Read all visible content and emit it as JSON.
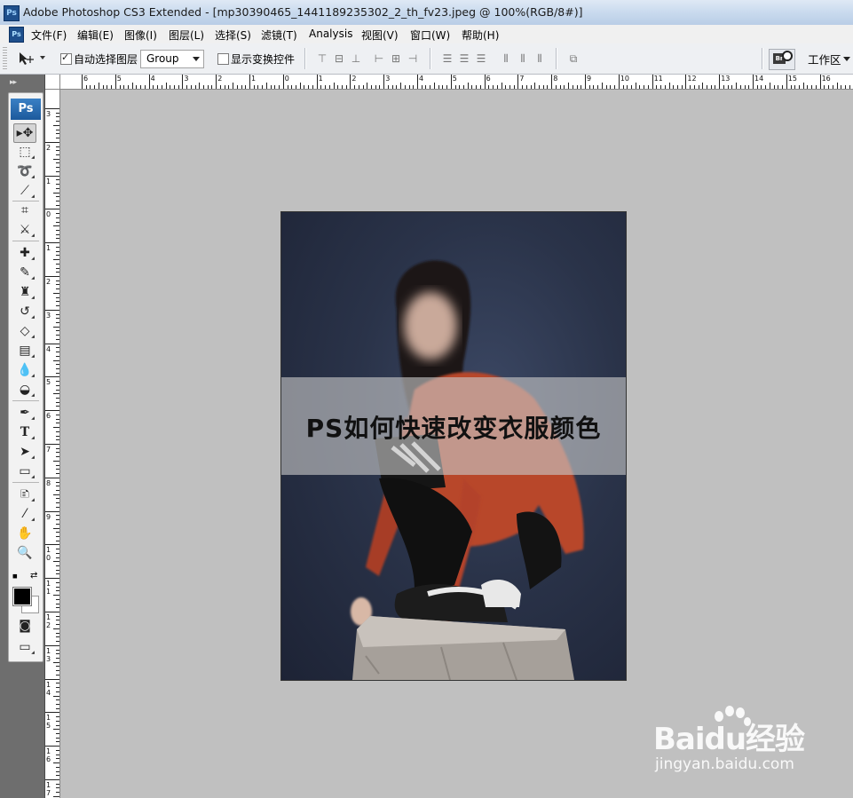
{
  "window": {
    "app_icon": "photoshop-icon",
    "title": "Adobe Photoshop CS3 Extended - [mp30390465_1441189235302_2_th_fv23.jpeg @ 100%(RGB/8#)]"
  },
  "menu": {
    "doc_icon_text": "Ps",
    "items": [
      "文件(F)",
      "编辑(E)",
      "图像(I)",
      "图层(L)",
      "选择(S)",
      "滤镜(T)",
      "Analysis",
      "视图(V)",
      "窗口(W)",
      "帮助(H)"
    ]
  },
  "options": {
    "tool_icon": "move-tool-icon",
    "auto_select_label": "自动选择图层",
    "auto_select_checked": true,
    "select_value": "Group",
    "show_transform_label": "显示变换控件",
    "show_transform_checked": false,
    "bridge_label": "Br",
    "workspace_label": "工作区"
  },
  "toolbox": {
    "logo": "Ps",
    "tools": [
      "move-tool-icon",
      "marquee-tool-icon",
      "lasso-tool-icon",
      "magic-wand-tool-icon",
      "crop-tool-icon",
      "slice-tool-icon",
      "healing-brush-icon",
      "brush-tool-icon",
      "clone-stamp-icon",
      "history-brush-icon",
      "eraser-tool-icon",
      "gradient-tool-icon",
      "blur-tool-icon",
      "dodge-tool-icon",
      "pen-tool-icon",
      "type-tool-icon",
      "path-selection-icon",
      "rectangle-tool-icon",
      "notes-tool-icon",
      "eyedropper-icon",
      "hand-tool-icon",
      "zoom-tool-icon"
    ],
    "foreground_color": "#000000",
    "background_color": "#ffffff"
  },
  "rulers": {
    "horizontal": [
      "6",
      "5",
      "4",
      "3",
      "2",
      "1",
      "0",
      "1",
      "2",
      "3",
      "4",
      "5",
      "6",
      "7",
      "8",
      "9",
      "10",
      "11",
      "12",
      "13",
      "14",
      "15",
      "16"
    ],
    "vertical": [
      "3",
      "2",
      "1",
      "0",
      "1",
      "2",
      "3",
      "4",
      "5",
      "6",
      "7",
      "8",
      "9",
      "10",
      "11",
      "12",
      "13",
      "14",
      "15",
      "16",
      "17"
    ]
  },
  "document": {
    "background_color": "#c0c0c0",
    "banner_text": "PS如何快速改变衣服颜色"
  },
  "watermark": {
    "logo": "Baidu经验",
    "url": "jingyan.baidu.com"
  }
}
